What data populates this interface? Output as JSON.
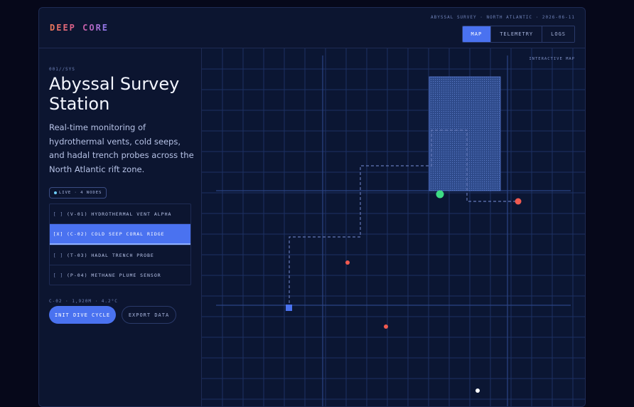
{
  "header": {
    "logo": "DEEP CORE",
    "meta": "ABYSSAL SURVEY · NORTH ATLANTIC · 2026-06-11",
    "tabs": [
      {
        "label": "MAP",
        "active": true
      },
      {
        "label": "TELEMETRY",
        "active": false
      },
      {
        "label": "LOGS",
        "active": false
      }
    ]
  },
  "sidebar": {
    "sys_label": "001//SYS",
    "title": "Abyssal Survey Station",
    "description": "Real-time monitoring of hydrothermal vents, cold seeps, and hadal trench probes across the North Atlantic rift zone.",
    "live_badge": "LIVE · 4 NODES",
    "nodes": [
      {
        "check": "[ ]",
        "label": "(V-01) HYDROTHERMAL VENT ALPHA",
        "selected": false
      },
      {
        "check": "[X]",
        "label": "(C-02) COLD SEEP CORAL RIDGE",
        "selected": true
      },
      {
        "check": "[ ]",
        "label": "(T-03) HADAL TRENCH PROBE",
        "selected": false
      },
      {
        "check": "[ ]",
        "label": "(P-04) METHANE PLUME SENSOR",
        "selected": false
      }
    ],
    "readout": "C-02 · 1,920M · 4.2°C",
    "primary_button": "INIT DIVE CYCLE",
    "secondary_button": "EXPORT DATA"
  },
  "map": {
    "label": "INTERACTIVE MAP"
  },
  "colors": {
    "accent": "#4a72f0",
    "marker_green": "#3ddc84",
    "marker_red": "#f05a50",
    "marker_square": "#4a72f0",
    "marker_white": "#ffffff"
  }
}
